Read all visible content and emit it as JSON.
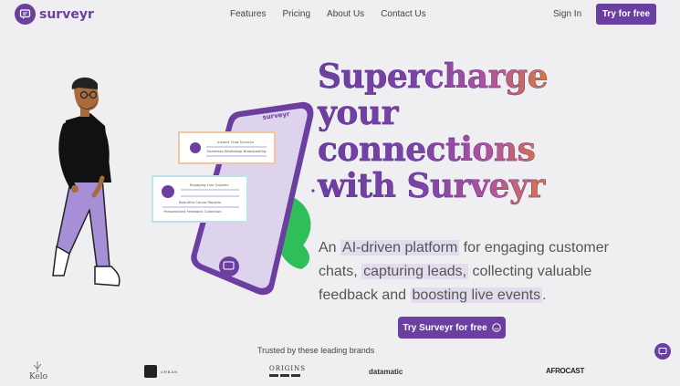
{
  "nav": {
    "logo_text": "surveyr",
    "links": [
      "Features",
      "Pricing",
      "About Us",
      "Contact Us"
    ],
    "signin": "Sign In",
    "try_free": "Try for free"
  },
  "hero": {
    "headline": [
      "Supercharge",
      "your",
      "connections",
      "with Surveyr"
    ],
    "sub": {
      "p1": "An ",
      "h1": "AI-driven platform",
      "p2": " for engaging customer chats, ",
      "h2": "capturing leads,",
      "p3": " collecting valuable feedback and ",
      "h3": "boosting live events",
      "p4": "."
    },
    "cta": "Try Surveyr for free"
  },
  "phone": {
    "brand": "surveyr",
    "card1": {
      "title": "Instant Chat Surveys",
      "line": "Seamless WhatsApp Broadcasting"
    },
    "card2": {
      "title": "Engaging Live Quizzes",
      "line1": "Beautiful Canva Reports",
      "line2": "Personalized Feedback Collection"
    }
  },
  "trusted": "Trusted by these leading brands",
  "brands": [
    "Kelo",
    "URBAN",
    "ORIGINS",
    "datamatic",
    "AFROCAST"
  ],
  "colors": {
    "brand": "#6b3fa0",
    "highlight": "#e3dcef",
    "background": "#efeff1"
  }
}
